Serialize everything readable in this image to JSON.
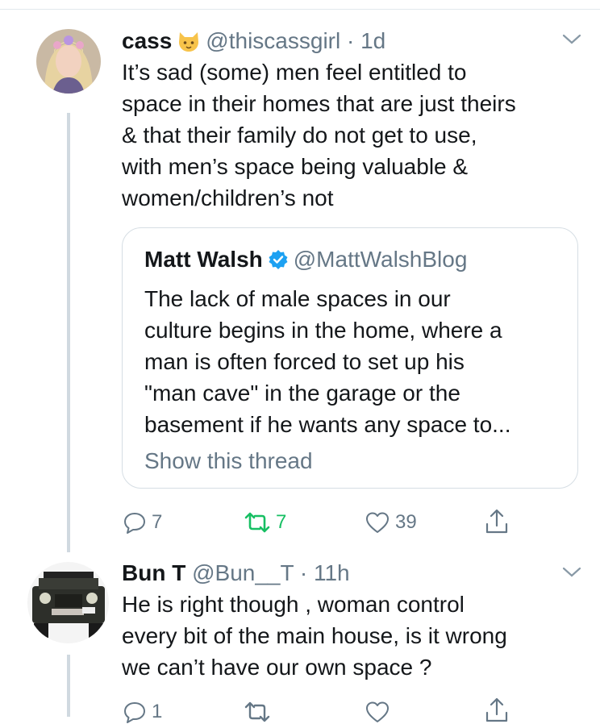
{
  "tweets": [
    {
      "name": "cass",
      "emoji": "cat-face",
      "handle": "@thiscassgirl",
      "time": "1d",
      "text_lines": [
        "It’s sad (some) men feel entitled to",
        "space in their homes that are just theirs",
        "& that their family do not get to use,",
        "with men’s space being valuable &",
        "women/children’s not"
      ],
      "quote": {
        "name": "Matt Walsh",
        "handle": "@MattWalshBlog",
        "text_lines": [
          "The lack of male spaces in our",
          "culture begins in the home, where a",
          "man is often forced to set up his",
          "\"man cave\" in the garage or the",
          "basement if he wants any space to..."
        ],
        "show_thread": "Show this thread"
      },
      "actions": {
        "replies": "7",
        "retweets": "7",
        "likes": "39"
      }
    },
    {
      "name": "Bun T",
      "handle": "@Bun__T",
      "time": "11h",
      "text_lines": [
        "He is right though , woman control",
        "every bit of the main house, is it wrong",
        "we can’t have our own space ?"
      ],
      "actions": {
        "replies": "1",
        "retweets": "",
        "likes": ""
      }
    }
  ],
  "colors": {
    "text": "#14171a",
    "muted": "#657786",
    "retweet_active": "#17bf63",
    "verified": "#1da1f2",
    "border": "#e1e8ed"
  }
}
